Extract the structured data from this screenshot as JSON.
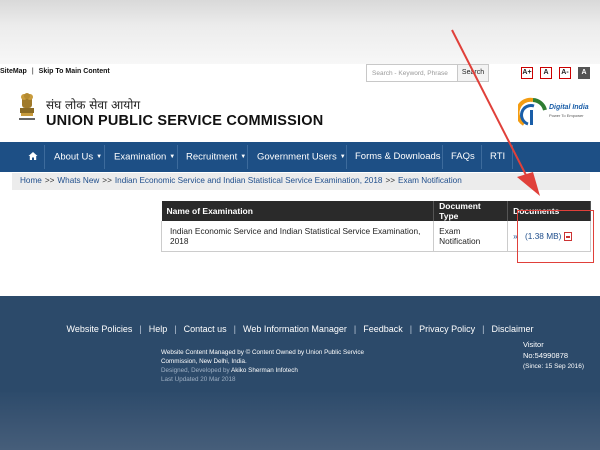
{
  "utility": {
    "sitemap": "SiteMap",
    "separator": "|",
    "skip": "Skip To Main Content",
    "search_placeholder": "Search - Keyword, Phrase",
    "search_button": "Search",
    "font_buttons": [
      "A+",
      "A",
      "A-",
      "A"
    ]
  },
  "header": {
    "title_hindi": "संघ लोक सेवा आयोग",
    "title_english": "UNION PUBLIC SERVICE COMMISSION",
    "emblem_caption": "सत्यमेव जयते",
    "digital_india": "Digital India",
    "digital_india_sub": "Power To Empower"
  },
  "nav": {
    "items": [
      "About Us",
      "Examination",
      "Recruitment",
      "Government Users",
      "Forms & Downloads",
      "FAQs",
      "RTI"
    ]
  },
  "breadcrumb": {
    "items": [
      "Home",
      "Whats New",
      "Indian Economic Service and Indian Statistical Service Examination, 2018",
      "Exam Notification"
    ],
    "separator": ">>"
  },
  "table": {
    "headers": [
      "Name of Examination",
      "Document Type",
      "Documents"
    ],
    "rows": [
      {
        "name": "Indian Economic Service and Indian Statistical Service Examination, 2018",
        "type": "Exam Notification",
        "bullet": "»",
        "doc": "(1.38 MB)"
      }
    ]
  },
  "footer": {
    "links": [
      "Website Policies",
      "Help",
      "Contact us",
      "Web Information Manager",
      "Feedback",
      "Privacy Policy",
      "Disclaimer"
    ],
    "managed_1": "Website Content Managed by © Content Owned by Union Public Service",
    "managed_2": "Commission, New Delhi, India.",
    "designed_prefix": "Designed, Developed by",
    "developer": "Akiko Sherman Infotech",
    "last_updated": "Last Updated 20 Mar 2018",
    "visitor_label": "Visitor",
    "visitor_count": "No:54990878",
    "visitor_since": "(Since: 15 Sep 2016)"
  },
  "colors": {
    "nav_bg": "#1d4f85",
    "footer_bg": "#2c4a6a",
    "link": "#1f4e8c",
    "annotation": "#e0403a"
  },
  "icons": {
    "home": "home-icon",
    "pdf": "pdf-icon"
  }
}
